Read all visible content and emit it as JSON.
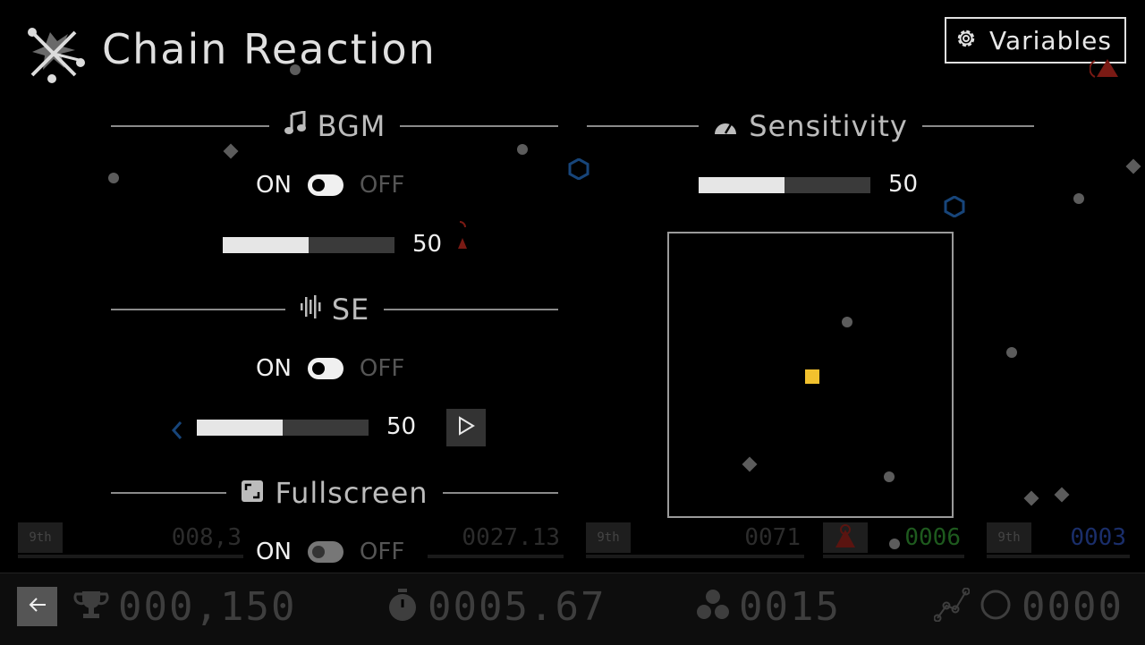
{
  "header": {
    "title": "Chain Reaction",
    "variables_label": "Variables"
  },
  "bgm": {
    "title": "BGM",
    "on_label": "ON",
    "off_label": "OFF",
    "enabled": true,
    "volume": 50
  },
  "se": {
    "title": "SE",
    "on_label": "ON",
    "off_label": "OFF",
    "enabled": true,
    "volume": 50
  },
  "fullscreen": {
    "title": "Fullscreen",
    "on_label": "ON",
    "off_label": "OFF",
    "enabled": true
  },
  "sensitivity": {
    "title": "Sensitivity",
    "value": 50
  },
  "ghost_rows": [
    {
      "rank": "9th",
      "value": "008,3"
    },
    {
      "rank": "9th",
      "value": "0027.13"
    },
    {
      "rank": "9th",
      "value": "0071"
    },
    {
      "rank": "",
      "value": "0006"
    },
    {
      "rank": "9th",
      "value": "0003"
    }
  ],
  "stats": {
    "score": "000,150",
    "time": "0005.67",
    "count": "0015",
    "links": "0000"
  },
  "colors": {
    "accent_yellow": "#f2c12e",
    "particle": "#5c5c5c",
    "ghost_green": "#1e5a1e",
    "ghost_blue": "#1a2e6a"
  },
  "icons": [
    "chain-reaction-logo-icon",
    "gear-icon",
    "music-note-icon",
    "gauge-icon",
    "sound-wave-icon",
    "fullscreen-icon",
    "play-icon",
    "back-arrow-icon",
    "trophy-icon",
    "stopwatch-icon",
    "cluster-icon",
    "graph-icon",
    "circle-icon"
  ]
}
